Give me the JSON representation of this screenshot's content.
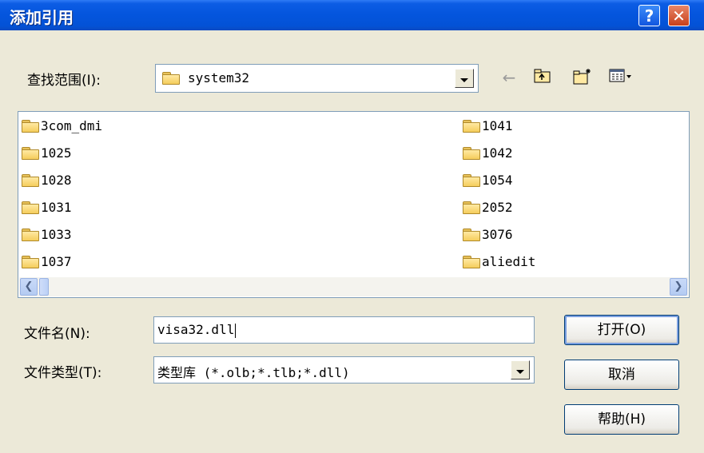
{
  "window": {
    "title": "添加引用",
    "help_label": "?",
    "close_label": "✕"
  },
  "look_in": {
    "label": "查找范围(I):",
    "value": "system32",
    "icons": [
      "back-arrow-icon",
      "up-folder-icon",
      "new-folder-icon",
      "view-menu-icon"
    ]
  },
  "files": {
    "left": [
      "3com_dmi",
      "1025",
      "1028",
      "1031",
      "1033",
      "1037"
    ],
    "right": [
      "1041",
      "1042",
      "1054",
      "2052",
      "3076",
      "aliedit"
    ]
  },
  "filename": {
    "label": "文件名(N):",
    "value": "visa32.dll"
  },
  "filetype": {
    "label": "文件类型(T):",
    "value": "类型库 (*.olb;*.tlb;*.dll)"
  },
  "buttons": {
    "open": "打开(O)",
    "cancel": "取消",
    "help": "帮助(H)"
  },
  "colors": {
    "titlebar": "#0455DD",
    "dialog_bg": "#ECE9D8",
    "border": "#7F9DB9"
  }
}
